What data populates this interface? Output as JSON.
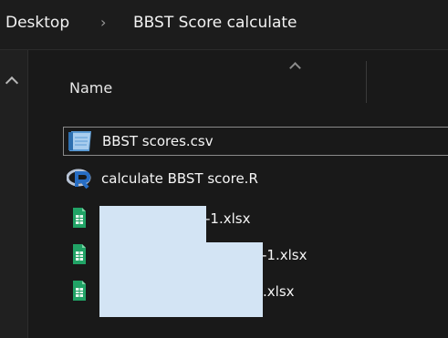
{
  "breadcrumb": {
    "items": [
      "Desktop",
      "BBST Score calculate"
    ],
    "separator": "›"
  },
  "list": {
    "column_header": "Name",
    "files": [
      {
        "name": "BBST scores.csv",
        "icon": "csv-file-icon",
        "selected": true
      },
      {
        "name": "calculate BBST score.R",
        "icon": "r-script-icon",
        "selected": false
      },
      {
        "name": "-1.xlsx",
        "icon": "excel-file-icon",
        "selected": false
      },
      {
        "name": "-1.xlsx",
        "icon": "excel-file-icon",
        "selected": false
      },
      {
        "name": ".xlsx",
        "icon": "excel-file-icon",
        "selected": false
      }
    ]
  },
  "colors": {
    "background": "#191919",
    "text": "#f5f5f5",
    "redaction": "#d3e4f4",
    "excel_green": "#21a366",
    "r_blue": "#276dc3"
  }
}
